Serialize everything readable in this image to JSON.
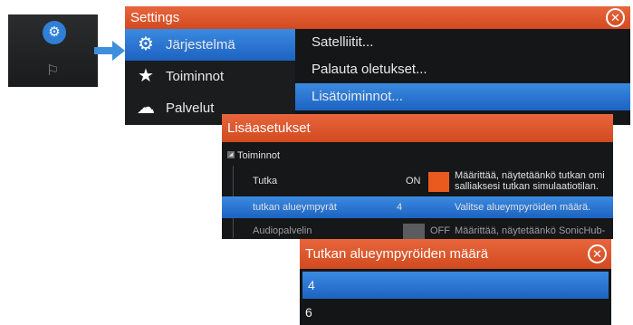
{
  "settings": {
    "title": "Settings",
    "close_icon": "close-icon",
    "nav": [
      {
        "label": "Järjestelmä",
        "icon": "gear-icon"
      },
      {
        "label": "Toiminnot",
        "icon": "star-icon"
      },
      {
        "label": "Palvelut",
        "icon": "cloud-icon"
      }
    ],
    "options": [
      {
        "label": "Satelliitit..."
      },
      {
        "label": "Palauta oletukset..."
      },
      {
        "label": "Lisätoiminnot..."
      }
    ]
  },
  "advanced": {
    "title": "Lisäasetukset",
    "group": "Toiminnot",
    "rows": [
      {
        "name": "Tutka",
        "value": "ON",
        "desc": "Määrittää, näytetäänkö tutkan omi",
        "desc2": "salliaksesi tutkan simulaatiotilan."
      },
      {
        "name": "tutkan alueympyrät",
        "value": "4",
        "desc": "Valitse alueympyröiden määrä."
      },
      {
        "name": "Audiopalvelin",
        "value": "OFF",
        "desc": "Määrittää, näytetäänkö SonicHub-"
      }
    ]
  },
  "dialog": {
    "title": "Tutkan alueympyröiden määrä",
    "options": [
      "4",
      "6"
    ]
  },
  "colors": {
    "accent_orange": "#e2572a",
    "selection_blue": "#2b74d0"
  }
}
